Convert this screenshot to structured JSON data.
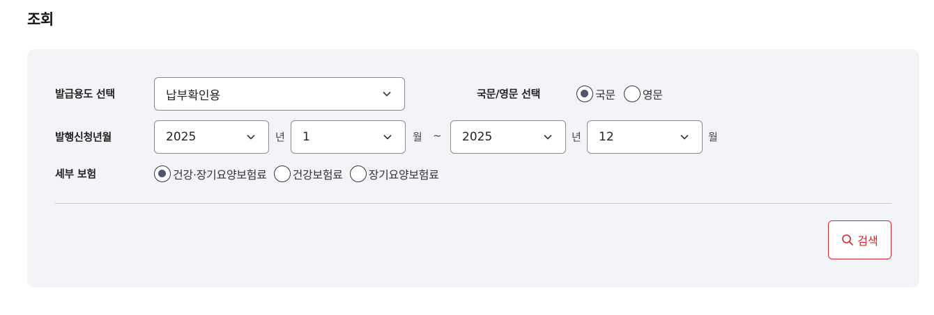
{
  "page": {
    "title": "조회"
  },
  "purpose": {
    "label": "발급용도 선택",
    "value": "납부확인용"
  },
  "language": {
    "label": "국문/영문 선택",
    "options": [
      {
        "label": "국문",
        "selected": true
      },
      {
        "label": "영문",
        "selected": false
      }
    ]
  },
  "period": {
    "label": "발행신청년월",
    "start_year": "2025",
    "start_month": "1",
    "end_year": "2025",
    "end_month": "12",
    "year_unit": "년",
    "month_unit": "월",
    "separator": "~"
  },
  "insurance": {
    "label": "세부 보험",
    "options": [
      {
        "label": "건강·장기요양보험료",
        "selected": true
      },
      {
        "label": "건강보험료",
        "selected": false
      },
      {
        "label": "장기요양보험료",
        "selected": false
      }
    ]
  },
  "actions": {
    "search_label": "검색"
  },
  "colors": {
    "panel_bg": "#f3f4f8",
    "accent_red": "#d6262b",
    "radio_fill": "#4f5468"
  },
  "icons": {
    "dropdown": "chevron-down-icon",
    "search": "search-icon"
  }
}
